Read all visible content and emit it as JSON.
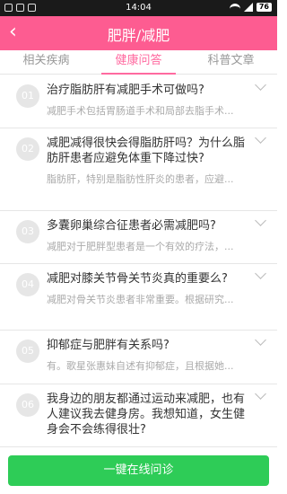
{
  "status_bar": {
    "time": "14:04",
    "battery": "76"
  },
  "app_bar": {
    "back_icon": "←",
    "title": "肥胖/减肥"
  },
  "tabs": [
    {
      "label": "相关疾病",
      "active": false
    },
    {
      "label": "健康问答",
      "active": true
    },
    {
      "label": "科普文章",
      "active": false
    }
  ],
  "items": [
    {
      "num": "01",
      "question": "治疗脂肪肝有减肥手术可做吗?",
      "answer": "减肥手术包括胃肠道手术和局部去脂手术..."
    },
    {
      "num": "02",
      "question": "减肥减得很快会得脂肪肝吗？为什么脂肪肝患者应避免体重下降过快?",
      "answer": "脂肪肝，特别是脂肪性肝炎的患者，应避..."
    },
    {
      "num": "03",
      "question": "多囊卵巢综合征患者必需减肥吗?",
      "answer": "减肥对于肥胖型患者是一个有效的疗法，..."
    },
    {
      "num": "04",
      "question": "减肥对膝关节骨关节炎真的重要么?",
      "answer": "减肥对骨关节炎患者非常重要。根据研究..."
    },
    {
      "num": "05",
      "question": "抑郁症与肥胖有关系吗?",
      "answer": "有。歌星张惠妹自述有抑郁症，且根据她..."
    },
    {
      "num": "06",
      "question": "我身边的朋友都通过运动来减肥，也有人建议我去健身房。我想知道，女生健身会不会练得很壮?",
      "answer": ""
    }
  ],
  "footer": {
    "ask_button": "一键在线问诊"
  }
}
